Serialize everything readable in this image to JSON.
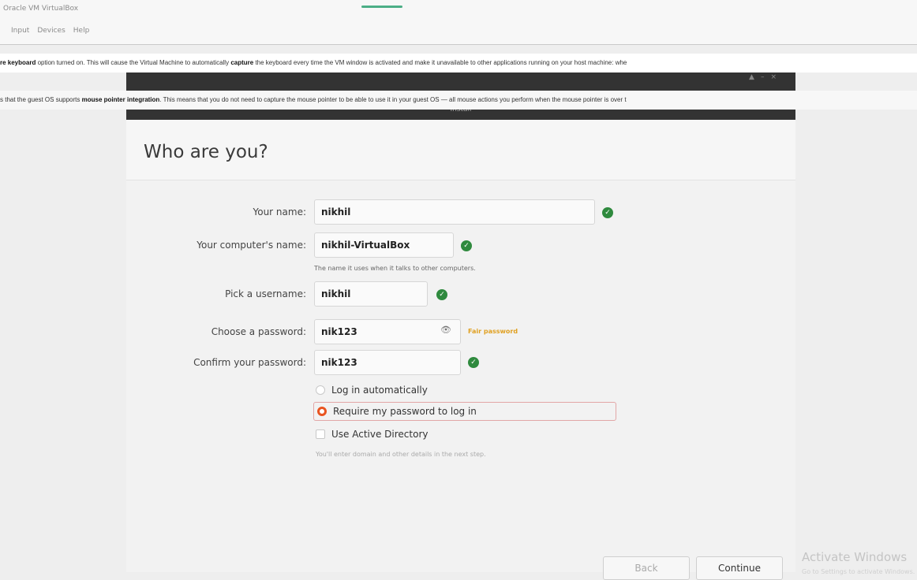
{
  "host": {
    "title": "Oracle VM VirtualBox",
    "menu": [
      "Input",
      "Devices",
      "Help"
    ],
    "notice1": {
      "prefix": "",
      "bold1": "re keyboard",
      "text1": " option turned on. This will cause the Virtual Machine to automatically ",
      "bold2": "capture",
      "text2": " the keyboard every time the VM window is activated and make it unavailable to other applications running on your host machine: whe"
    },
    "notice2": {
      "text1": "s that the guest OS supports ",
      "bold1": "mouse pointer integration",
      "text2": ". This means that you do not need to capture the mouse pointer to be able to use it in your guest OS — all mouse actions you perform when the mouse pointer is over t"
    }
  },
  "vm": {
    "window_title": "",
    "section": "Install"
  },
  "installer": {
    "page_title": "Who are you?",
    "name_label": "Your name:",
    "name_value": "nikhil",
    "computer_label": "Your computer's name:",
    "computer_value": "nikhil-VirtualBox",
    "computer_hint": "The name it uses when it talks to other computers.",
    "username_label": "Pick a username:",
    "username_value": "nikhil",
    "password_label": "Choose a password:",
    "password_value": "nik123",
    "password_strength": "Fair password",
    "confirm_label": "Confirm your password:",
    "confirm_value": "nik123",
    "opt_auto_login": "Log in automatically",
    "opt_require_password": "Require my password to log in",
    "opt_active_directory": "Use Active Directory",
    "ad_hint": "You'll enter domain and other details in the next step.",
    "back_label": "Back",
    "continue_label": "Continue",
    "selected_option": "require_password",
    "accent_color": "#e95420",
    "ok_color": "#2f8a3e"
  },
  "watermark": {
    "title": "Activate Windows",
    "subtitle": "Go to Settings to activate Windows."
  }
}
